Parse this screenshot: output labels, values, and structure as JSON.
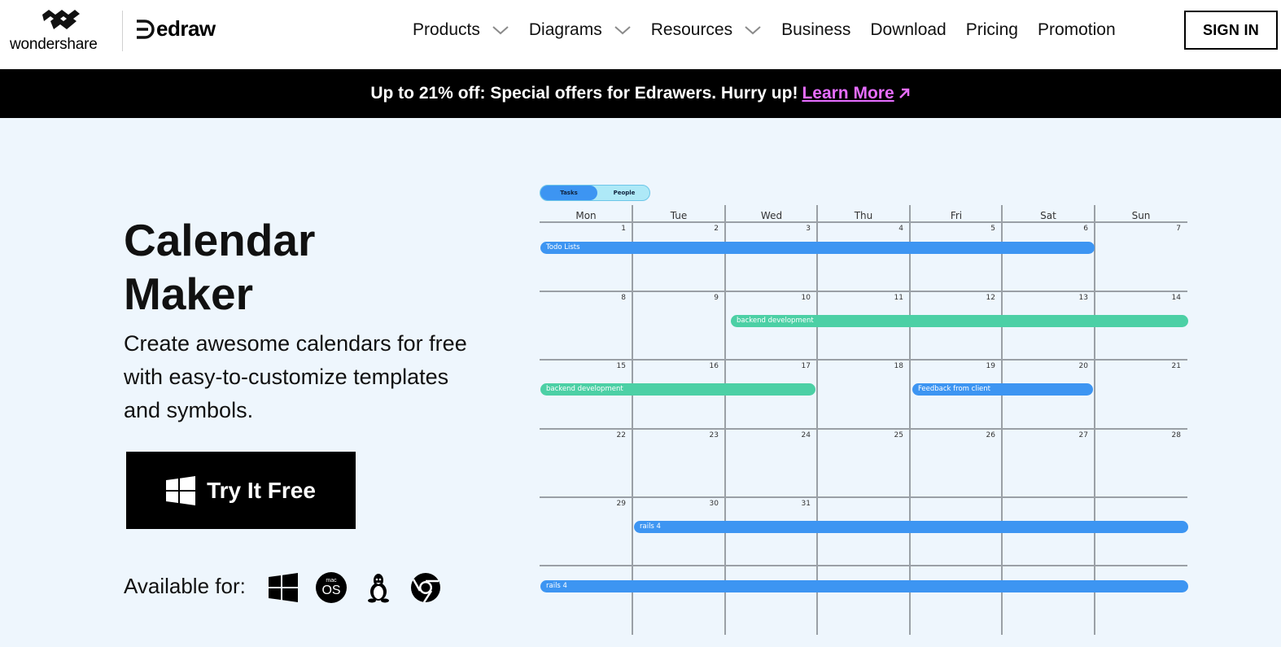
{
  "brand": {
    "wondershare": "wondershare",
    "edraw": "edraw"
  },
  "nav": {
    "products": "Products",
    "diagrams": "Diagrams",
    "resources": "Resources",
    "business": "Business",
    "download": "Download",
    "pricing": "Pricing",
    "promotion": "Promotion",
    "signin": "SIGN IN"
  },
  "promo": {
    "text": "Up to 21% off: Special offers for Edrawers. Hurry up!",
    "link": "Learn More",
    "link_color": "#e66dff"
  },
  "hero": {
    "title_line1": "Calendar",
    "title_line2": "Maker",
    "subtitle": "Create awesome calendars for free with easy-to-customize templates and symbols.",
    "cta": "Try It Free",
    "available_label": "Available for:",
    "platforms": [
      "windows-icon",
      "macos-icon",
      "linux-icon",
      "chrome-icon"
    ],
    "macos_small": "mac",
    "macos_big": "OS"
  },
  "calendar": {
    "toggle": {
      "tasks": "Tasks",
      "people": "People"
    },
    "days": [
      "Mon",
      "Tue",
      "Wed",
      "Thu",
      "Fri",
      "Sat",
      "Sun"
    ],
    "weeks": [
      [
        "1",
        "2",
        "3",
        "4",
        "5",
        "6",
        "7"
      ],
      [
        "8",
        "9",
        "10",
        "11",
        "12",
        "13",
        "14"
      ],
      [
        "15",
        "16",
        "17",
        "18",
        "19",
        "20",
        "21"
      ],
      [
        "22",
        "23",
        "24",
        "25",
        "26",
        "27",
        "28"
      ],
      [
        "29",
        "30",
        "31",
        "",
        "",
        "",
        ""
      ]
    ],
    "events": [
      {
        "label": "Todo Lists",
        "color": "#3d95f2"
      },
      {
        "label": "backend development",
        "color": "#4cd0a5"
      },
      {
        "label": "backend development",
        "color": "#4cd0a5"
      },
      {
        "label": "Feedback from client",
        "color": "#3d95f2"
      },
      {
        "label": "rails 4",
        "color": "#3d95f2"
      },
      {
        "label": "rails 4",
        "color": "#3d95f2"
      }
    ]
  }
}
